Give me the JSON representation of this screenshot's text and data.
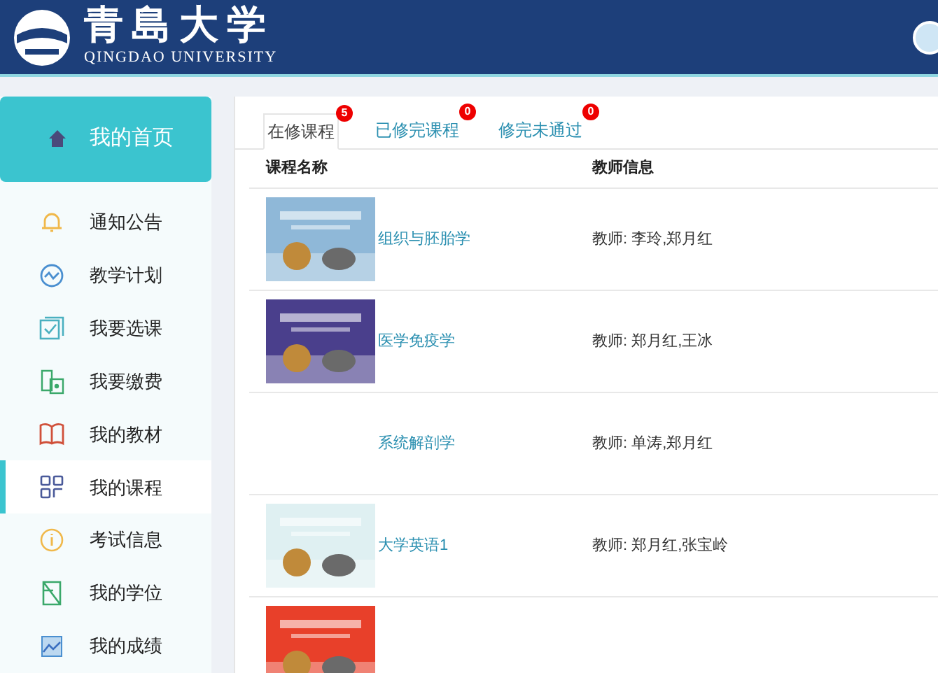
{
  "header": {
    "logo_title": "青島大学",
    "logo_subtitle": "QINGDAO UNIVERSITY"
  },
  "sidebar": {
    "home": {
      "label": "我的首页"
    },
    "items": [
      {
        "label": "通知公告",
        "selected": false
      },
      {
        "label": "教学计划",
        "selected": false
      },
      {
        "label": "我要选课",
        "selected": false
      },
      {
        "label": "我要缴费",
        "selected": false
      },
      {
        "label": "我的教材",
        "selected": false
      },
      {
        "label": "我的课程",
        "selected": true
      },
      {
        "label": "考试信息",
        "selected": false
      },
      {
        "label": "我的学位",
        "selected": false
      },
      {
        "label": "我的成绩",
        "selected": false
      }
    ]
  },
  "tabs": [
    {
      "label": "在修课程",
      "count": "5",
      "selected": true
    },
    {
      "label": "已修完课程",
      "count": "0",
      "selected": false
    },
    {
      "label": "修完未通过",
      "count": "0",
      "selected": false
    }
  ],
  "table": {
    "columns": [
      "课程名称",
      "教师信息"
    ],
    "rows": [
      {
        "cover": {
          "kind": "picture"
        },
        "name": "组织与胚胎学",
        "teacher": "教师: 李玲,郑月红"
      },
      {
        "cover": {
          "kind": "picture"
        },
        "name": "医学免疫学",
        "teacher": "教师: 郑月红,王冰"
      },
      {
        "name": "系统解剖学",
        "teacher": "教师: 单涛,郑月红"
      },
      {
        "cover": {
          "kind": "picture"
        },
        "name": "大学英语1",
        "teacher": "教师: 郑月红,张宝岭"
      },
      {
        "cover": {
          "kind": "picture"
        }
      }
    ]
  }
}
